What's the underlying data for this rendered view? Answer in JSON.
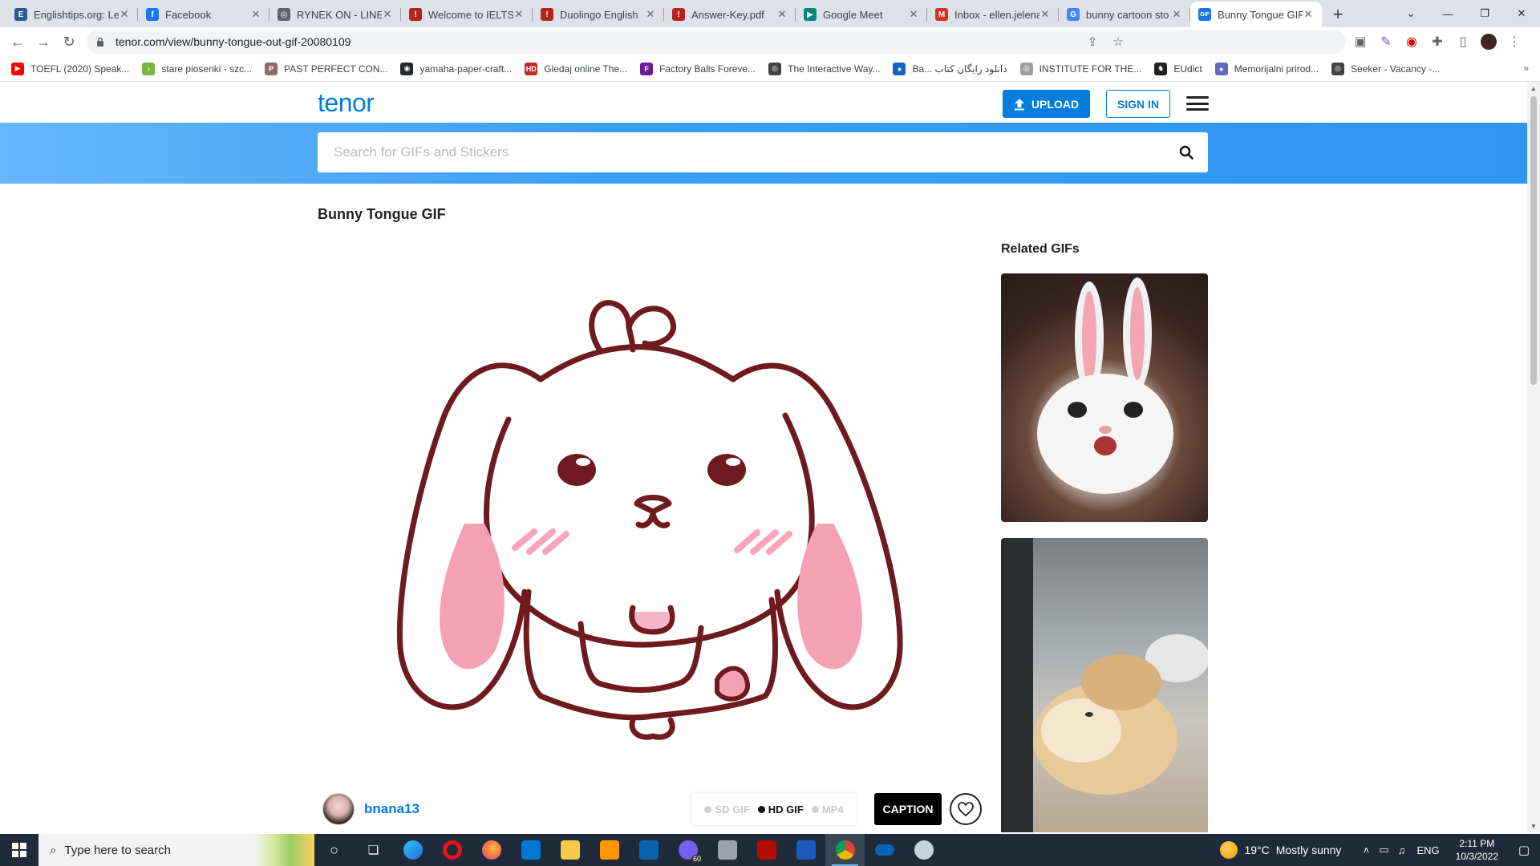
{
  "browser": {
    "tabs": [
      {
        "title": "Englishtips.org: Lea",
        "fav_color": "#2b5797",
        "fav_glyph": "E"
      },
      {
        "title": "Facebook",
        "fav_color": "#1877f2",
        "fav_glyph": "f"
      },
      {
        "title": "RYNEK ON - LINE",
        "fav_color": "#5f6368",
        "fav_glyph": "◎"
      },
      {
        "title": "Welcome to IELTS",
        "fav_color": "#b3261e",
        "fav_glyph": "!"
      },
      {
        "title": "Duolingo English",
        "fav_color": "#b3261e",
        "fav_glyph": "!"
      },
      {
        "title": "Answer-Key.pdf",
        "fav_color": "#b3261e",
        "fav_glyph": "!"
      },
      {
        "title": "Google Meet",
        "fav_color": "#00897b",
        "fav_glyph": "▶"
      },
      {
        "title": "Inbox - ellen.jelena",
        "fav_color": "#d93025",
        "fav_glyph": "M"
      },
      {
        "title": "bunny cartoon sto",
        "fav_color": "#4285f4",
        "fav_glyph": "G"
      },
      {
        "title": "Bunny Tongue GIF",
        "fav_color": "#1a73e8",
        "fav_glyph": "GIF"
      }
    ],
    "url": "tenor.com/view/bunny-tongue-out-gif-20080109",
    "bookmarks": [
      {
        "label": "TOEFL (2020) Speak...",
        "color": "#ff0000",
        "glyph": "▶"
      },
      {
        "label": "stare piosenki - szc...",
        "color": "#7cb342",
        "glyph": "♪"
      },
      {
        "label": "PAST PERFECT CON...",
        "color": "#8d6e63",
        "glyph": "P"
      },
      {
        "label": "yamaha-paper-craft...",
        "color": "#24292e",
        "glyph": "◉"
      },
      {
        "label": "Gledaj online The...",
        "color": "#c62828",
        "glyph": "HD"
      },
      {
        "label": "Factory Balls Foreve...",
        "color": "#6a1b9a",
        "glyph": "F"
      },
      {
        "label": "The Interactive Way...",
        "color": "#424242",
        "glyph": "◎"
      },
      {
        "label": "Ba... دانلود رایگان کتاب",
        "color": "#1565c0",
        "glyph": "●"
      },
      {
        "label": "INSTITUTE FOR THE...",
        "color": "#9e9e9e",
        "glyph": "◎"
      },
      {
        "label": "EUdict",
        "color": "#212121",
        "glyph": "♞"
      },
      {
        "label": "Memorijalni prirod...",
        "color": "#5c6bc0",
        "glyph": "●"
      },
      {
        "label": "Seeker - Vacancy -...",
        "color": "#424242",
        "glyph": "◎"
      }
    ]
  },
  "tenor": {
    "logo": "tenor",
    "upload_label": "UPLOAD",
    "signin_label": "SIGN IN",
    "search_placeholder": "Search for GIFs and Stickers",
    "gif_title": "Bunny Tongue GIF",
    "related_title": "Related GIFs",
    "author": "bnana13",
    "formats": [
      {
        "label": "SD GIF",
        "active": false
      },
      {
        "label": "HD GIF",
        "active": true
      },
      {
        "label": "MP4",
        "active": false
      }
    ],
    "caption_label": "CAPTION"
  },
  "taskbar": {
    "search_placeholder": "Type here to search",
    "weather_temp": "19°C",
    "weather_text": "Mostly sunny",
    "lang": "ENG",
    "time": "2:11 PM",
    "date": "10/3/2022",
    "viber_badge": "60",
    "apps": [
      "task-view",
      "edge",
      "opera",
      "firefox",
      "store",
      "file-explorer",
      "sublime",
      "outlook",
      "viber",
      "printer",
      "acrobat",
      "word",
      "chrome",
      "onedrive",
      "app-misc"
    ]
  }
}
